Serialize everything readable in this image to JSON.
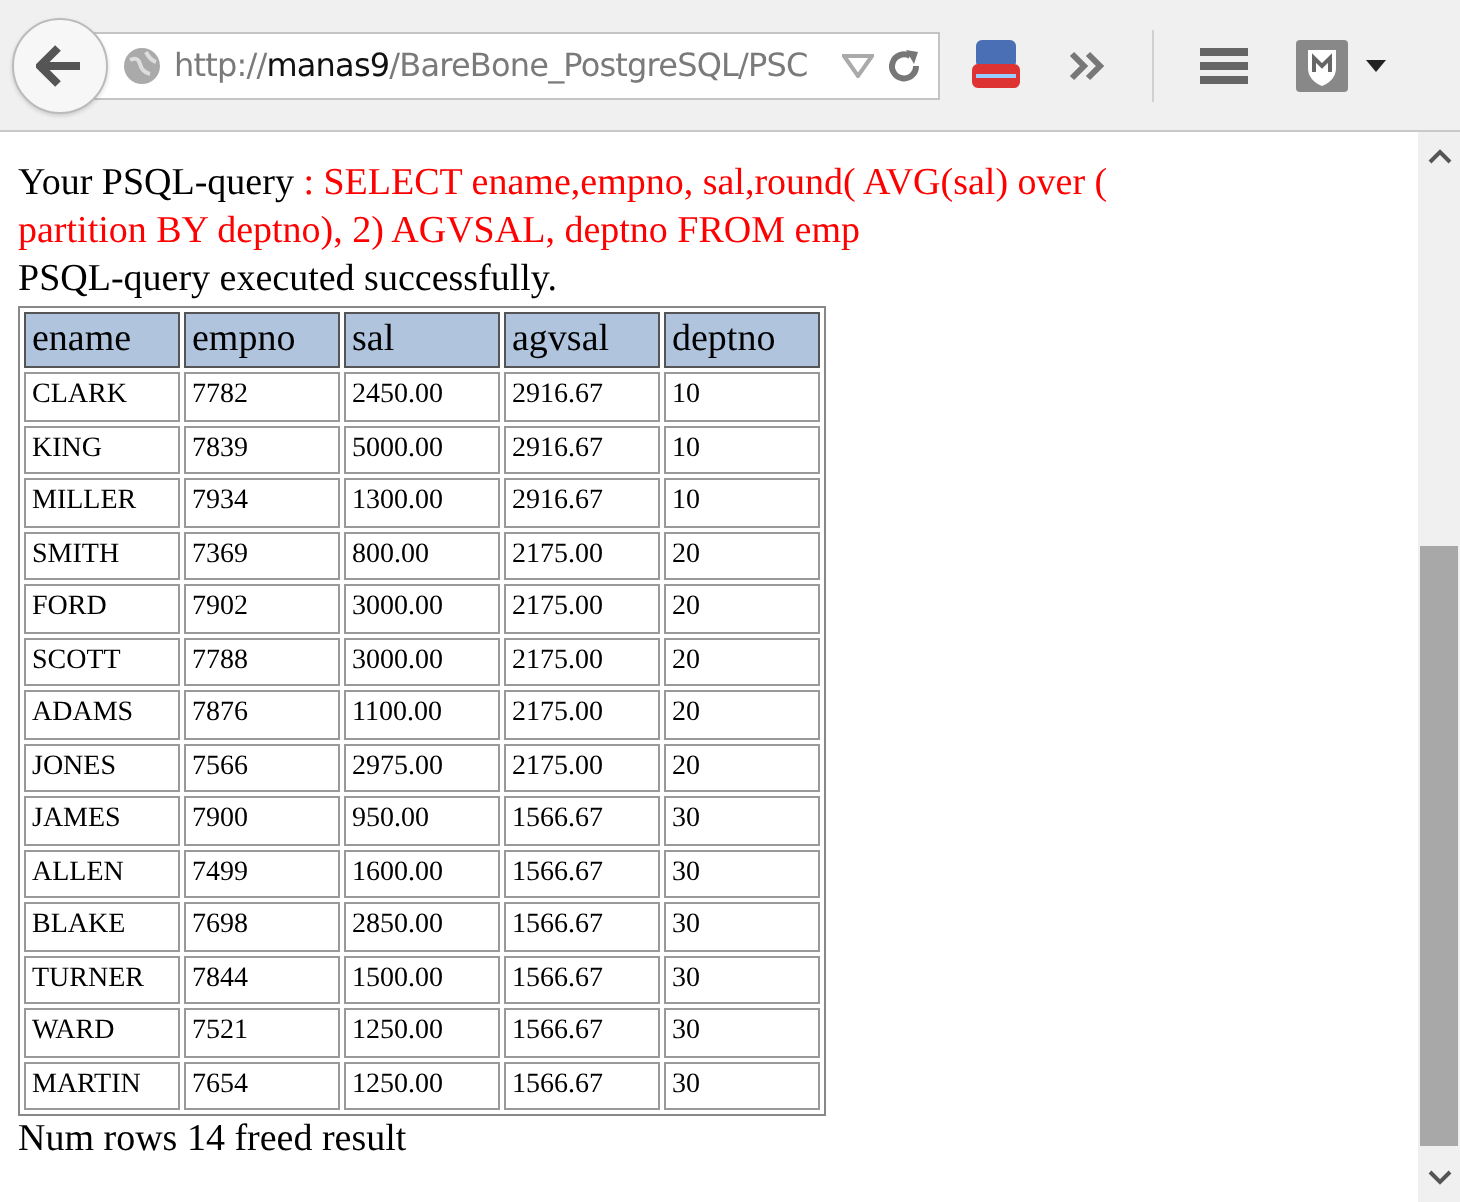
{
  "toolbar": {
    "url": {
      "scheme": "http://",
      "host": "manas9",
      "path": "/BareBone_PostgreSQL/PSC"
    }
  },
  "page": {
    "query_label": "Your PSQL-query ",
    "query": ": SELECT ename,empno, sal,round( AVG(sal) over ( partition BY deptno), 2) AGVSAL, deptno FROM emp",
    "status": "PSQL-query executed successfully.",
    "table": {
      "columns": [
        "ename",
        "empno",
        "sal",
        "agvsal",
        "deptno"
      ],
      "rows": [
        [
          "CLARK",
          "7782",
          "2450.00",
          "2916.67",
          "10"
        ],
        [
          "KING",
          "7839",
          "5000.00",
          "2916.67",
          "10"
        ],
        [
          "MILLER",
          "7934",
          "1300.00",
          "2916.67",
          "10"
        ],
        [
          "SMITH",
          "7369",
          "800.00",
          "2175.00",
          "20"
        ],
        [
          "FORD",
          "7902",
          "3000.00",
          "2175.00",
          "20"
        ],
        [
          "SCOTT",
          "7788",
          "3000.00",
          "2175.00",
          "20"
        ],
        [
          "ADAMS",
          "7876",
          "1100.00",
          "2175.00",
          "20"
        ],
        [
          "JONES",
          "7566",
          "2975.00",
          "2175.00",
          "20"
        ],
        [
          "JAMES",
          "7900",
          "950.00",
          "1566.67",
          "30"
        ],
        [
          "ALLEN",
          "7499",
          "1600.00",
          "1566.67",
          "30"
        ],
        [
          "BLAKE",
          "7698",
          "2850.00",
          "1566.67",
          "30"
        ],
        [
          "TURNER",
          "7844",
          "1500.00",
          "1566.67",
          "30"
        ],
        [
          "WARD",
          "7521",
          "1250.00",
          "1566.67",
          "30"
        ],
        [
          "MARTIN",
          "7654",
          "1250.00",
          "1566.67",
          "30"
        ]
      ]
    },
    "footer": "Num rows 14 freed result"
  }
}
